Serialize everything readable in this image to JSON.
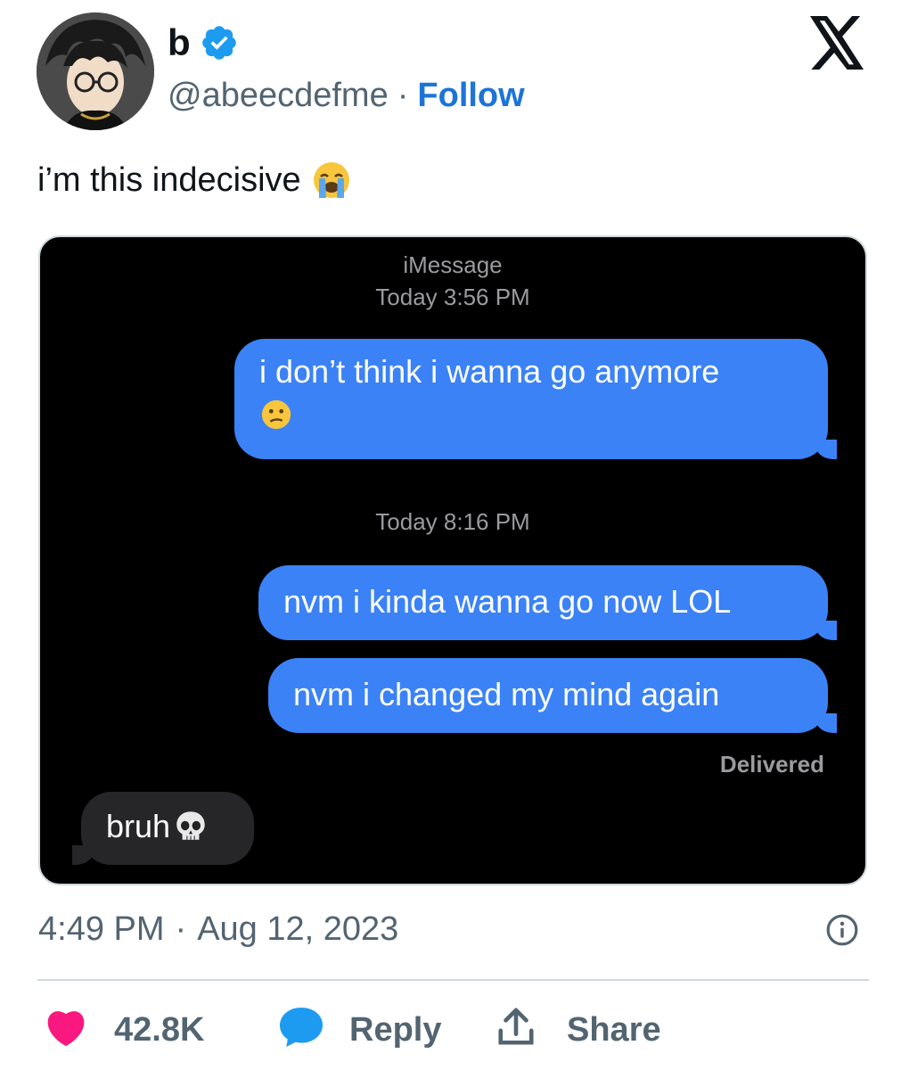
{
  "author": {
    "name": "b",
    "handle": "@abeecdefme",
    "separator": "·",
    "follow_label": "Follow",
    "verified_color": "#1d9bf0"
  },
  "tweet": {
    "text": "i’m this indecisive",
    "emoji": "loudly-crying-face"
  },
  "imessage": {
    "service": "iMessage",
    "time_1": "Today 3:56 PM",
    "time_2": "Today 8:16 PM",
    "messages": [
      {
        "direction": "sent",
        "text": "i don’t think i wanna go anymore",
        "emoji": "confused-face"
      },
      {
        "direction": "sent",
        "text": "nvm i kinda wanna go now LOL"
      },
      {
        "direction": "sent",
        "text": "nvm i changed my mind again"
      },
      {
        "direction": "received",
        "text": "bruh",
        "emoji": "skull"
      }
    ],
    "delivered": "Delivered",
    "sent_bubble_color": "#3b82f6",
    "received_bubble_color": "#262628"
  },
  "meta": {
    "time": "4:49 PM",
    "separator": "·",
    "date": "Aug 12, 2023"
  },
  "actions": {
    "like_count": "42.8K",
    "reply_label": "Reply",
    "share_label": "Share",
    "like_color": "#f91880",
    "reply_color": "#1d9bf0"
  }
}
